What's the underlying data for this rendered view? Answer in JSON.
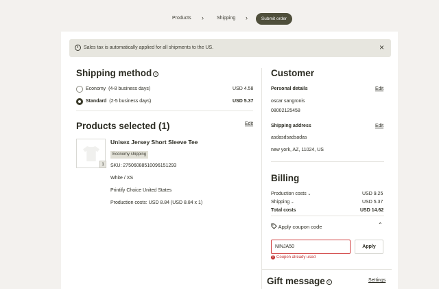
{
  "breadcrumb": {
    "items": [
      "Products",
      "Shipping"
    ],
    "active": "Submit order",
    "separator": "›"
  },
  "notice": {
    "icon": "info-icon",
    "text": "Sales tax is automatically applied for all shipments to the US.",
    "close": "×"
  },
  "shipping": {
    "title": "Shipping method",
    "options": [
      {
        "name": "Economy",
        "detail": "(4-8 business days)",
        "price": "USD 4.58",
        "selected": false
      },
      {
        "name": "Standard",
        "detail": "(2-5 business days)",
        "price": "USD 5.37",
        "selected": true
      }
    ]
  },
  "products": {
    "title": "Products selected (1)",
    "edit": "Edit",
    "item": {
      "name": "Unisex Jersey Short Sleeve Tee",
      "badge": "Economy shipping",
      "qty": "1",
      "sku": "SKU: 27506088510096151293",
      "variant": "White / XS",
      "provider": "Printify Choice United States",
      "cost": "Production costs: USD 8.84 (USD 8.84 x 1)"
    }
  },
  "customer": {
    "title": "Customer",
    "personal_label": "Personal details",
    "personal_edit": "Edit",
    "name": "oscar sangronis",
    "phone": "08002125458",
    "address_label": "Shipping address",
    "address_edit": "Edit",
    "address_line": "asdasdsadsadas",
    "city_line": "new york, AZ, 11024, US"
  },
  "billing": {
    "title": "Billing",
    "production_label": "Production costs",
    "production_value": "USD 9.25",
    "shipping_label": "Shipping",
    "shipping_value": "USD 5.37",
    "total_label": "Total costs",
    "total_value": "USD 14.62",
    "coupon_toggle": "Apply coupon code",
    "coupon_value": "NINJA50",
    "apply": "Apply",
    "coupon_error": "Coupon already used"
  },
  "gift": {
    "title": "Gift message",
    "settings": "Settings"
  },
  "colors": {
    "accent": "#4f4f3b",
    "error": "#c03030",
    "notice_bg": "#e7e6df"
  }
}
